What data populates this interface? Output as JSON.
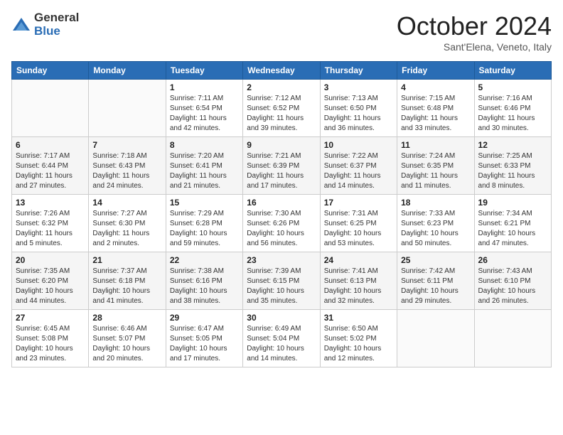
{
  "logo": {
    "general": "General",
    "blue": "Blue"
  },
  "title": "October 2024",
  "subtitle": "Sant'Elena, Veneto, Italy",
  "headers": [
    "Sunday",
    "Monday",
    "Tuesday",
    "Wednesday",
    "Thursday",
    "Friday",
    "Saturday"
  ],
  "weeks": [
    [
      {
        "day": "",
        "info": ""
      },
      {
        "day": "",
        "info": ""
      },
      {
        "day": "1",
        "info": "Sunrise: 7:11 AM\nSunset: 6:54 PM\nDaylight: 11 hours and 42 minutes."
      },
      {
        "day": "2",
        "info": "Sunrise: 7:12 AM\nSunset: 6:52 PM\nDaylight: 11 hours and 39 minutes."
      },
      {
        "day": "3",
        "info": "Sunrise: 7:13 AM\nSunset: 6:50 PM\nDaylight: 11 hours and 36 minutes."
      },
      {
        "day": "4",
        "info": "Sunrise: 7:15 AM\nSunset: 6:48 PM\nDaylight: 11 hours and 33 minutes."
      },
      {
        "day": "5",
        "info": "Sunrise: 7:16 AM\nSunset: 6:46 PM\nDaylight: 11 hours and 30 minutes."
      }
    ],
    [
      {
        "day": "6",
        "info": "Sunrise: 7:17 AM\nSunset: 6:44 PM\nDaylight: 11 hours and 27 minutes."
      },
      {
        "day": "7",
        "info": "Sunrise: 7:18 AM\nSunset: 6:43 PM\nDaylight: 11 hours and 24 minutes."
      },
      {
        "day": "8",
        "info": "Sunrise: 7:20 AM\nSunset: 6:41 PM\nDaylight: 11 hours and 21 minutes."
      },
      {
        "day": "9",
        "info": "Sunrise: 7:21 AM\nSunset: 6:39 PM\nDaylight: 11 hours and 17 minutes."
      },
      {
        "day": "10",
        "info": "Sunrise: 7:22 AM\nSunset: 6:37 PM\nDaylight: 11 hours and 14 minutes."
      },
      {
        "day": "11",
        "info": "Sunrise: 7:24 AM\nSunset: 6:35 PM\nDaylight: 11 hours and 11 minutes."
      },
      {
        "day": "12",
        "info": "Sunrise: 7:25 AM\nSunset: 6:33 PM\nDaylight: 11 hours and 8 minutes."
      }
    ],
    [
      {
        "day": "13",
        "info": "Sunrise: 7:26 AM\nSunset: 6:32 PM\nDaylight: 11 hours and 5 minutes."
      },
      {
        "day": "14",
        "info": "Sunrise: 7:27 AM\nSunset: 6:30 PM\nDaylight: 11 hours and 2 minutes."
      },
      {
        "day": "15",
        "info": "Sunrise: 7:29 AM\nSunset: 6:28 PM\nDaylight: 10 hours and 59 minutes."
      },
      {
        "day": "16",
        "info": "Sunrise: 7:30 AM\nSunset: 6:26 PM\nDaylight: 10 hours and 56 minutes."
      },
      {
        "day": "17",
        "info": "Sunrise: 7:31 AM\nSunset: 6:25 PM\nDaylight: 10 hours and 53 minutes."
      },
      {
        "day": "18",
        "info": "Sunrise: 7:33 AM\nSunset: 6:23 PM\nDaylight: 10 hours and 50 minutes."
      },
      {
        "day": "19",
        "info": "Sunrise: 7:34 AM\nSunset: 6:21 PM\nDaylight: 10 hours and 47 minutes."
      }
    ],
    [
      {
        "day": "20",
        "info": "Sunrise: 7:35 AM\nSunset: 6:20 PM\nDaylight: 10 hours and 44 minutes."
      },
      {
        "day": "21",
        "info": "Sunrise: 7:37 AM\nSunset: 6:18 PM\nDaylight: 10 hours and 41 minutes."
      },
      {
        "day": "22",
        "info": "Sunrise: 7:38 AM\nSunset: 6:16 PM\nDaylight: 10 hours and 38 minutes."
      },
      {
        "day": "23",
        "info": "Sunrise: 7:39 AM\nSunset: 6:15 PM\nDaylight: 10 hours and 35 minutes."
      },
      {
        "day": "24",
        "info": "Sunrise: 7:41 AM\nSunset: 6:13 PM\nDaylight: 10 hours and 32 minutes."
      },
      {
        "day": "25",
        "info": "Sunrise: 7:42 AM\nSunset: 6:11 PM\nDaylight: 10 hours and 29 minutes."
      },
      {
        "day": "26",
        "info": "Sunrise: 7:43 AM\nSunset: 6:10 PM\nDaylight: 10 hours and 26 minutes."
      }
    ],
    [
      {
        "day": "27",
        "info": "Sunrise: 6:45 AM\nSunset: 5:08 PM\nDaylight: 10 hours and 23 minutes."
      },
      {
        "day": "28",
        "info": "Sunrise: 6:46 AM\nSunset: 5:07 PM\nDaylight: 10 hours and 20 minutes."
      },
      {
        "day": "29",
        "info": "Sunrise: 6:47 AM\nSunset: 5:05 PM\nDaylight: 10 hours and 17 minutes."
      },
      {
        "day": "30",
        "info": "Sunrise: 6:49 AM\nSunset: 5:04 PM\nDaylight: 10 hours and 14 minutes."
      },
      {
        "day": "31",
        "info": "Sunrise: 6:50 AM\nSunset: 5:02 PM\nDaylight: 10 hours and 12 minutes."
      },
      {
        "day": "",
        "info": ""
      },
      {
        "day": "",
        "info": ""
      }
    ]
  ]
}
